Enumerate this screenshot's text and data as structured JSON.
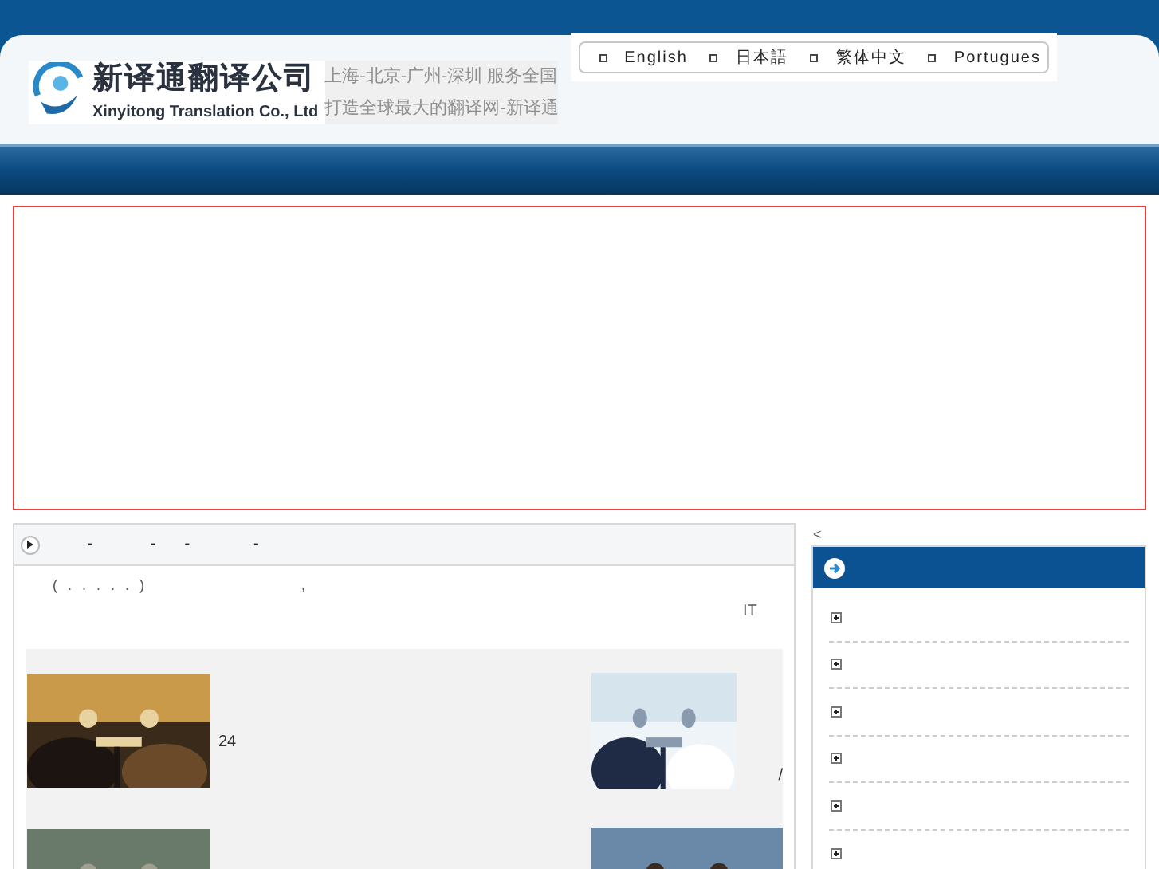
{
  "header": {
    "company_name": "新译通翻译公司",
    "company_english": "Xinyitong Translation Co., Ltd",
    "tagline_1": "上海-北京-广州-深圳 服务全国",
    "tagline_2": "打造全球最大的翻译网-新译通"
  },
  "languages": [
    "English",
    "日本語",
    "繁体中文",
    "Portugues"
  ],
  "main_panel": {
    "title_marks": [
      "-",
      "-",
      "-",
      "-"
    ],
    "intro_1": "( . . . . . )",
    "intro_2": ",",
    "intro_3": "IT",
    "gallery": [
      {
        "kind": "picture",
        "caption": "24"
      },
      {
        "kind": "picture",
        "caption": "/"
      },
      {
        "kind": "picture"
      },
      {
        "kind": "picture"
      }
    ]
  },
  "sidebar": {
    "top_mark": "<",
    "items": [
      {
        "expanded": false
      },
      {
        "expanded": false
      },
      {
        "expanded": false
      },
      {
        "expanded": false
      },
      {
        "expanded": false
      },
      {
        "expanded": false
      }
    ]
  }
}
